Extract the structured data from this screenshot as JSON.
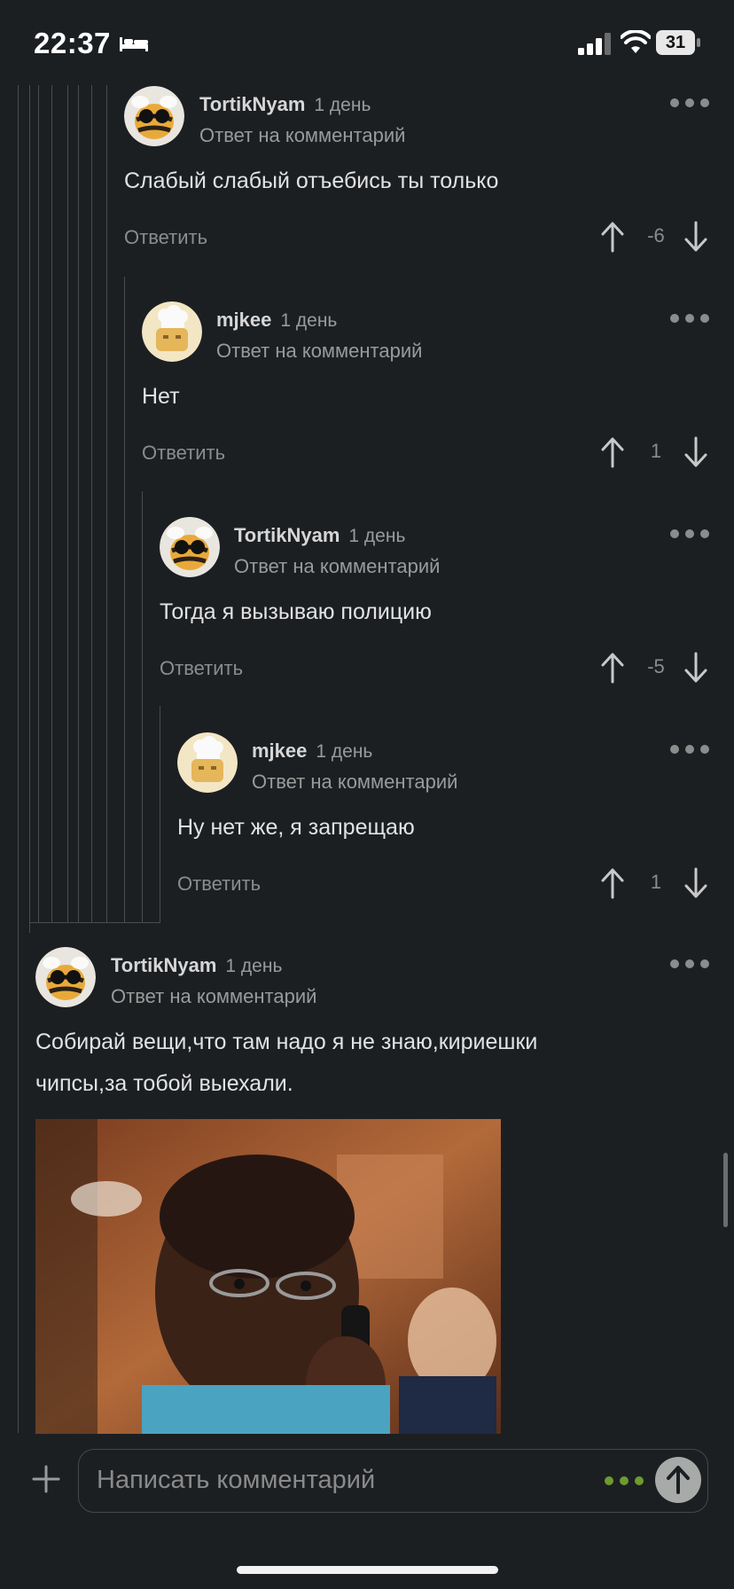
{
  "status_bar": {
    "time": "22:37",
    "battery": "31"
  },
  "comments": [
    {
      "author": "TortikNyam",
      "time": "1 день",
      "reply_to": "Ответ на комментарий",
      "text": "Слабый слабый отъебись ты только",
      "reply_label": "Ответить",
      "score": "-6",
      "avatar": "bee"
    },
    {
      "author": "mjkee",
      "time": "1 день",
      "reply_to": "Ответ на комментарий",
      "text": "Нет",
      "reply_label": "Ответить",
      "score": "1",
      "avatar": "chef"
    },
    {
      "author": "TortikNyam",
      "time": "1 день",
      "reply_to": "Ответ на комментарий",
      "text": "Тогда я вызываю полицию",
      "reply_label": "Ответить",
      "score": "-5",
      "avatar": "bee"
    },
    {
      "author": "mjkee",
      "time": "1 день",
      "reply_to": "Ответ на комментарий",
      "text": "Ну нет же, я запрещаю",
      "reply_label": "Ответить",
      "score": "1",
      "avatar": "chef"
    },
    {
      "author": "TortikNyam",
      "time": "1 день",
      "reply_to": "Ответ на комментарий",
      "text_line1": "Собирай вещи,что там надо я не знаю,кириешки",
      "text_line2": "чипсы,за тобой выехали.",
      "avatar": "bee",
      "attachment": "photo"
    }
  ],
  "composer": {
    "placeholder": "Написать комментарий"
  },
  "colors": {
    "background": "#1c1f22",
    "accent": "#6f9a2e",
    "muted_text": "#8c8c8c"
  }
}
